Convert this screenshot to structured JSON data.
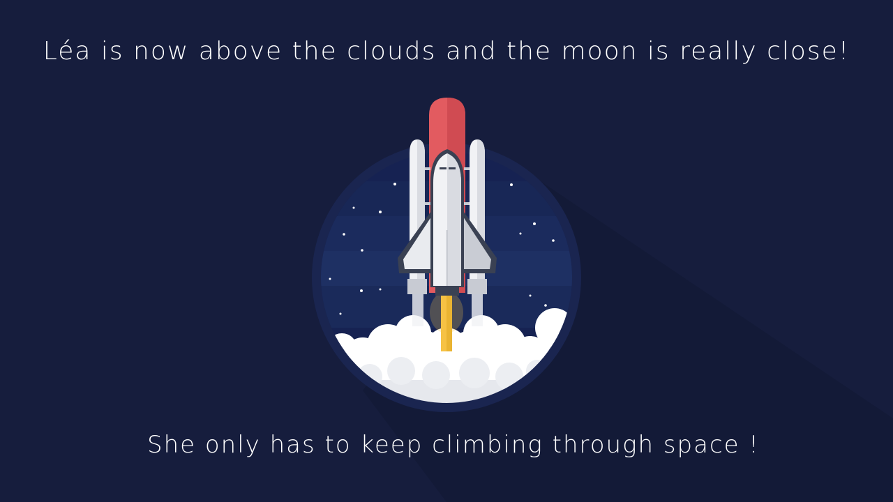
{
  "story": {
    "line_top": "Léa is now above the clouds and the moon is really close!",
    "line_bottom": "She only has to keep climbing through space !"
  },
  "colors": {
    "background": "#161d3d",
    "circle_sky": "#1c2c5e",
    "tank_red": "#e25b60",
    "shuttle_white": "#f1f2f5",
    "flame": "#f6c244",
    "cloud": "#ffffff"
  },
  "icons": {
    "illustration": "space-shuttle-launch-icon"
  }
}
